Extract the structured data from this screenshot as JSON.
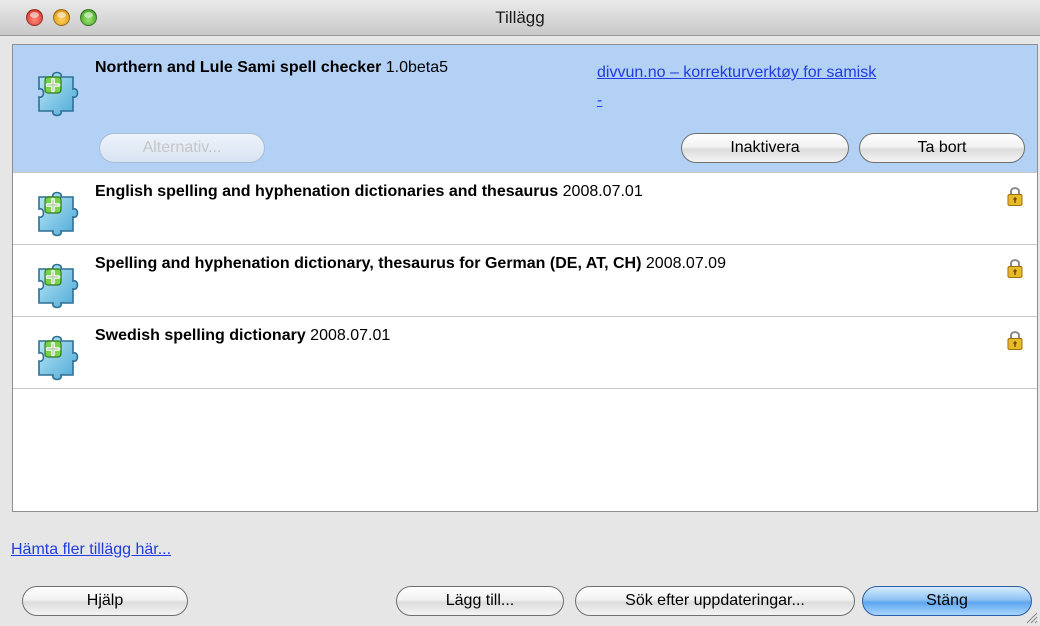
{
  "window": {
    "title": "Tillägg"
  },
  "extensions": [
    {
      "name": "Northern and Lule Sami spell checker",
      "version": "1.0beta5",
      "link_line1": "divvun.no – korrekturverktøy for samisk",
      "link_line2": "-",
      "selected": true,
      "locked": false,
      "buttons": {
        "options": "Alternativ...",
        "disable": "Inaktivera",
        "remove": "Ta bort"
      }
    },
    {
      "name": "English spelling and hyphenation dictionaries and thesaurus",
      "version": "2008.07.01",
      "locked": true
    },
    {
      "name": "Spelling and hyphenation dictionary, thesaurus for German (DE, AT, CH)",
      "version": "2008.07.09",
      "locked": true
    },
    {
      "name": "Swedish spelling dictionary",
      "version": "2008.07.01",
      "locked": true
    }
  ],
  "footer": {
    "get_more_link": "Hämta fler tillägg här...",
    "help": "Hjälp",
    "add": "Lägg till...",
    "check_updates": "Sök efter uppdateringar...",
    "close": "Stäng"
  },
  "colors": {
    "selection": "#b3d0f5",
    "link": "#1f3de0",
    "default_button": "#5ea6ee"
  },
  "icons": {
    "extension": "puzzle-piece-icon",
    "locked": "lock-icon"
  }
}
